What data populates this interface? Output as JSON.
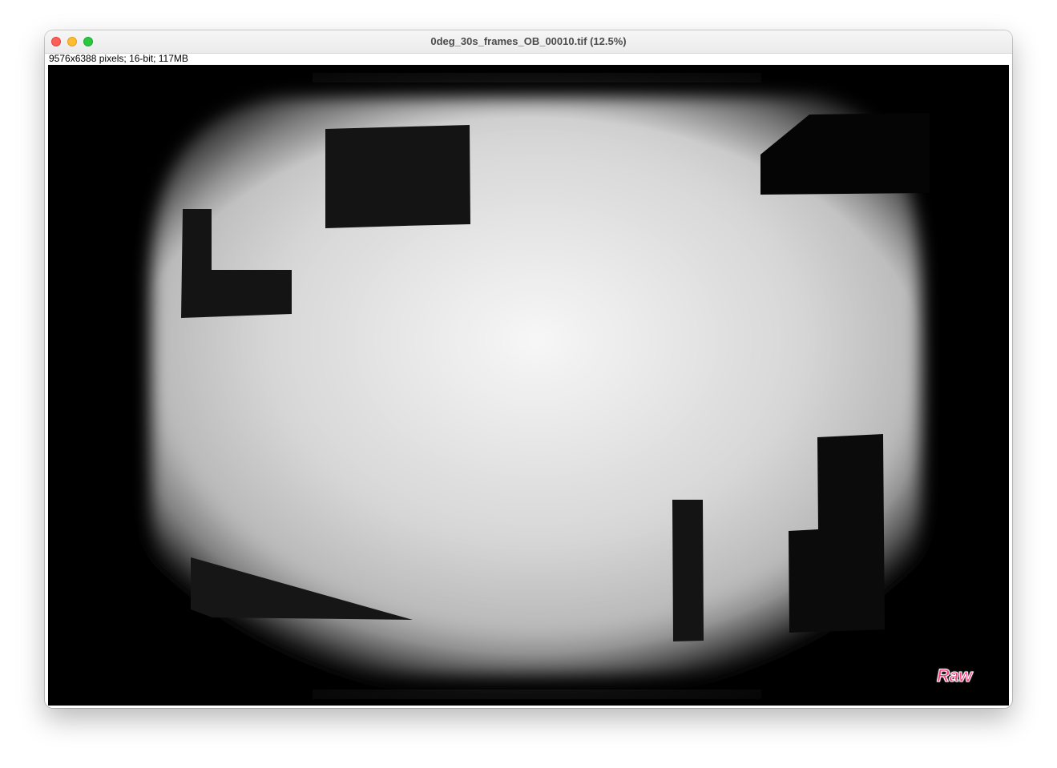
{
  "window": {
    "title": "0deg_30s_frames_OB_00010.tif (12.5%)",
    "controls": {
      "close_color": "#fe5f57",
      "minimize_color": "#febc2e",
      "maximize_color": "#28c840"
    }
  },
  "image_info": "9576x6388 pixels; 16-bit; 117MB",
  "image": {
    "mode_badge": "Raw",
    "badge_color": "#ff3d7f"
  }
}
